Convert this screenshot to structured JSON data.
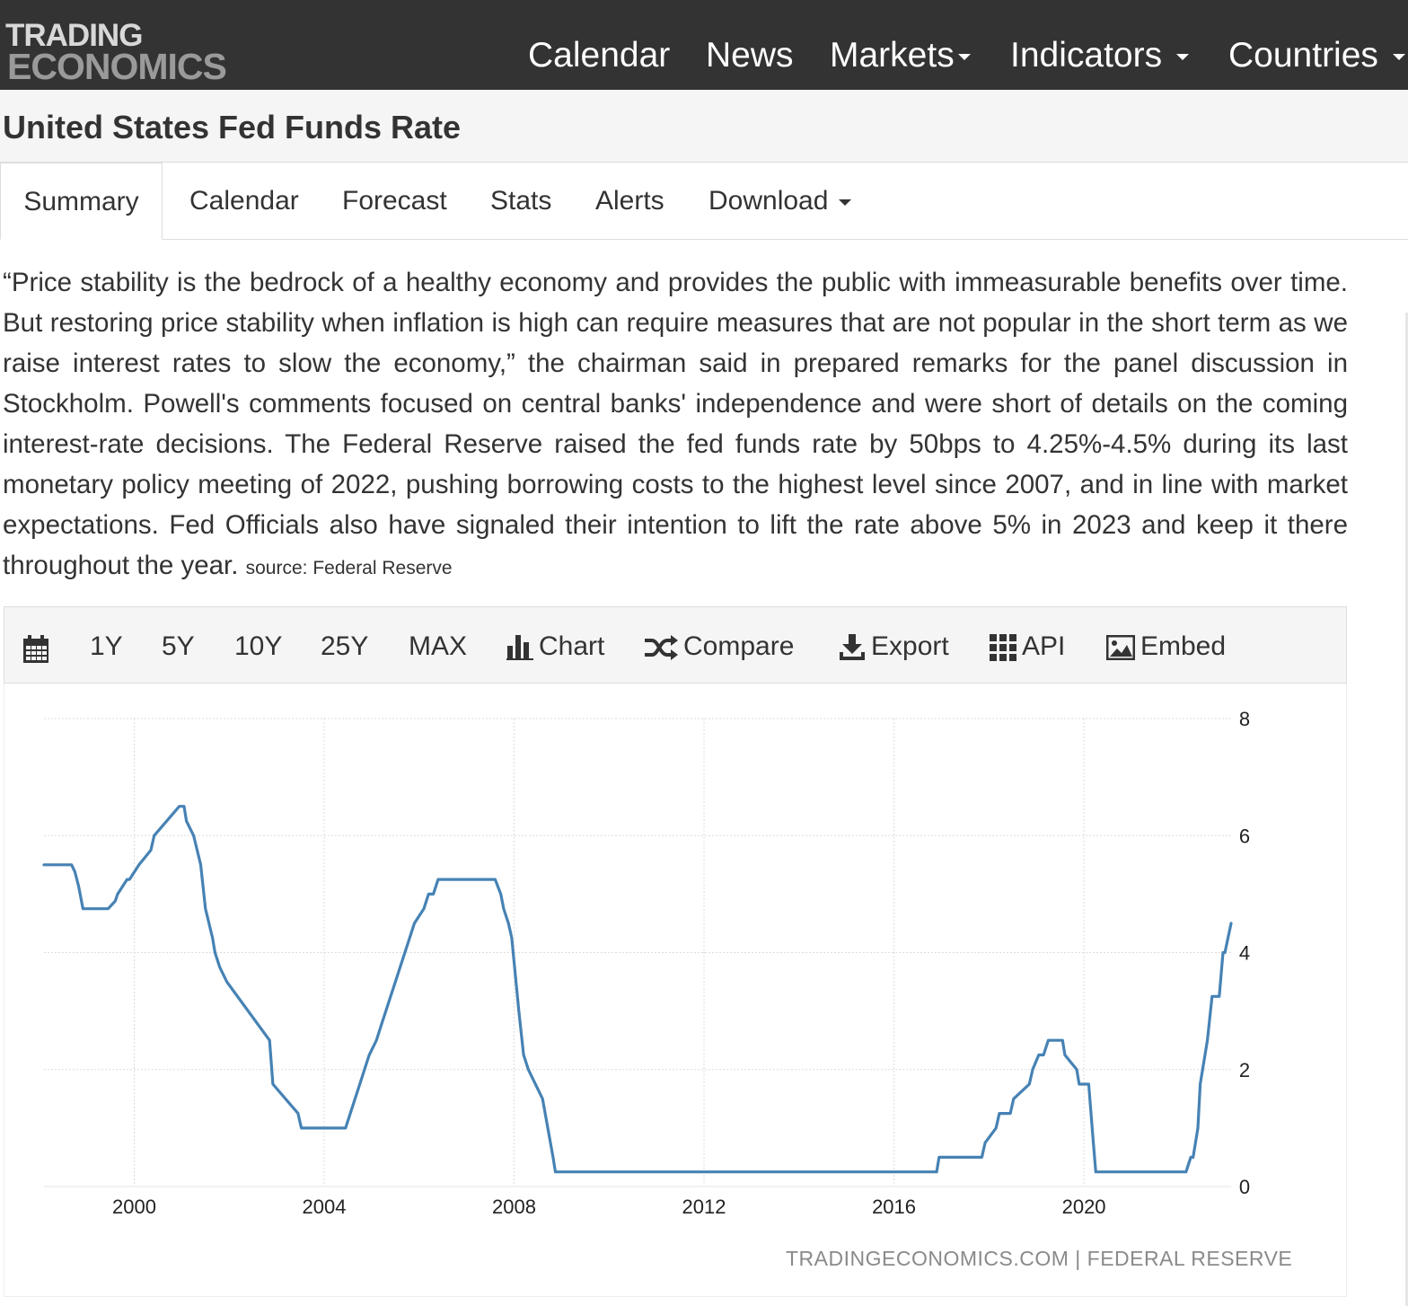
{
  "nav": {
    "logo_line1": "TRADING",
    "logo_line2": "ECONOMICS",
    "items": [
      {
        "label": "Calendar",
        "has_caret": false
      },
      {
        "label": "News",
        "has_caret": false
      },
      {
        "label": "Markets",
        "has_caret": true
      },
      {
        "label": "Indicators",
        "has_caret": true
      },
      {
        "label": "Countries",
        "has_caret": true
      }
    ]
  },
  "page": {
    "title": "United States Fed Funds Rate"
  },
  "tabs": [
    {
      "label": "Summary",
      "active": true
    },
    {
      "label": "Calendar",
      "active": false
    },
    {
      "label": "Forecast",
      "active": false
    },
    {
      "label": "Stats",
      "active": false
    },
    {
      "label": "Alerts",
      "active": false
    },
    {
      "label": "Download",
      "active": false,
      "has_caret": true
    }
  ],
  "summary": {
    "text": "“Price stability is the bedrock of a healthy economy and provides the public with immeasurable benefits over time. But restoring price stability when inflation is high can require measures that are not popular in the short term as we raise interest rates to slow the economy,” the chairman said in prepared remarks for the panel discussion in Stockholm. Powell's comments focused on central banks' independence and were short of details on the coming interest-rate decisions. The Federal Reserve raised the fed funds rate by 50bps to 4.25%-4.5% during its last monetary policy meeting of 2022, pushing borrowing costs to the highest level since 2007, and in line with market expectations. Fed Officials also have signaled their intention to lift the rate above 5% in 2023 and keep it there throughout the year.",
    "source": "source: Federal Reserve"
  },
  "toolbar": {
    "calendar_icon": "calendar-icon",
    "ranges": [
      "1Y",
      "5Y",
      "10Y",
      "25Y",
      "MAX"
    ],
    "chart_label": "Chart",
    "compare_label": "Compare",
    "export_label": "Export",
    "api_label": "API",
    "embed_label": "Embed"
  },
  "chart_attribution": "TRADINGECONOMICS.COM  |  FEDERAL RESERVE",
  "chart_data": {
    "type": "line",
    "title": "",
    "xlabel": "",
    "ylabel": "",
    "line_color": "#4682b4",
    "grid": true,
    "xlim": [
      1998.1,
      2023.1
    ],
    "ylim": [
      0,
      8
    ],
    "x_ticks": [
      "2000",
      "2004",
      "2008",
      "2012",
      "2016",
      "2020"
    ],
    "y_ticks": [
      "0",
      "2",
      "4",
      "6",
      "8"
    ],
    "x": [
      1998.1,
      1998.68,
      1998.75,
      1998.83,
      1998.92,
      1999.45,
      1999.6,
      1999.65,
      1999.85,
      1999.9,
      2000.1,
      2000.35,
      2000.42,
      2000.95,
      2001.05,
      2001.1,
      2001.25,
      2001.4,
      2001.5,
      2001.65,
      2001.7,
      2001.8,
      2001.95,
      2002.85,
      2002.92,
      2003.45,
      2003.52,
      2004.45,
      2004.55,
      2004.65,
      2004.75,
      2004.85,
      2004.95,
      2005.1,
      2005.2,
      2005.3,
      2005.4,
      2005.5,
      2005.6,
      2005.7,
      2005.8,
      2005.9,
      2006.1,
      2006.2,
      2006.3,
      2006.4,
      2006.5,
      2007.6,
      2007.72,
      2007.78,
      2007.88,
      2007.95,
      2008.1,
      2008.2,
      2008.3,
      2008.6,
      2008.82,
      2008.87,
      2008.95,
      2016.9,
      2016.95,
      2017.85,
      2017.92,
      2018.15,
      2018.22,
      2018.45,
      2018.52,
      2018.85,
      2018.92,
      2019.05,
      2019.15,
      2019.25,
      2019.32,
      2019.4,
      2019.55,
      2019.6,
      2019.85,
      2019.9,
      2019.97,
      2020.1,
      2020.2,
      2020.25,
      2022.15,
      2022.25,
      2022.3,
      2022.4,
      2022.45,
      2022.6,
      2022.7,
      2022.85,
      2022.93,
      2022.97,
      2023.1
    ],
    "y": [
      5.5,
      5.5,
      5.38,
      5.13,
      4.75,
      4.75,
      4.88,
      5.0,
      5.25,
      5.25,
      5.5,
      5.75,
      6.0,
      6.5,
      6.5,
      6.25,
      6.0,
      5.5,
      4.75,
      4.25,
      4.0,
      3.75,
      3.5,
      2.5,
      1.75,
      1.25,
      1.0,
      1.0,
      1.25,
      1.5,
      1.75,
      2.0,
      2.25,
      2.5,
      2.75,
      3.0,
      3.25,
      3.5,
      3.75,
      4.0,
      4.25,
      4.5,
      4.75,
      5.0,
      5.0,
      5.25,
      5.25,
      5.25,
      5.0,
      4.75,
      4.5,
      4.25,
      3.0,
      2.25,
      2.0,
      1.5,
      0.5,
      0.25,
      0.25,
      0.25,
      0.5,
      0.5,
      0.75,
      1.0,
      1.25,
      1.25,
      1.5,
      1.75,
      2.0,
      2.25,
      2.25,
      2.5,
      2.5,
      2.5,
      2.5,
      2.25,
      2.0,
      1.75,
      1.75,
      1.75,
      0.75,
      0.25,
      0.25,
      0.5,
      0.5,
      1.0,
      1.75,
      2.5,
      3.25,
      3.25,
      4.0,
      4.0,
      4.5
    ]
  }
}
